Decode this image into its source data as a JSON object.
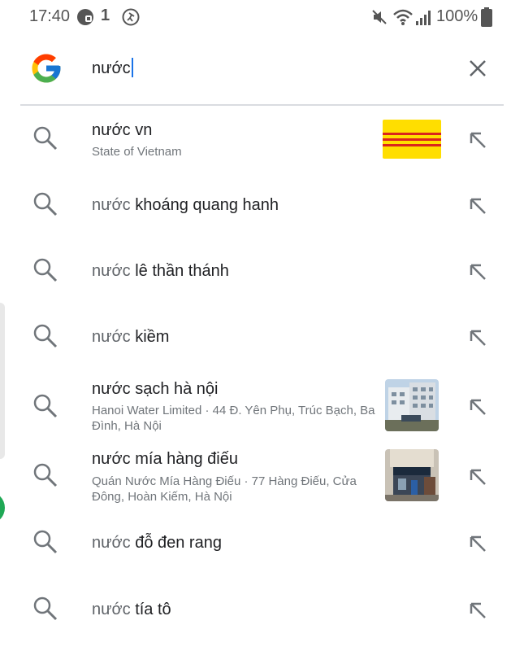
{
  "status_bar": {
    "time": "17:40",
    "battery": "100%",
    "icons": [
      "facebook-messenger-icon",
      "notification-count-icon",
      "activity-icon",
      "mute-icon",
      "wifi-icon",
      "signal-icon",
      "battery-icon"
    ],
    "notification_badge": "1"
  },
  "search": {
    "query": "nước",
    "logo": "google-logo",
    "clear_icon": "close-icon"
  },
  "suggestions": [
    {
      "prefix": "nước",
      "rest": " vn",
      "subtitle": "State of Vietnam",
      "thumb": "flag"
    },
    {
      "prefix": "nước",
      "rest": " khoáng quang hanh"
    },
    {
      "prefix": "nước",
      "rest": " lê thần thánh"
    },
    {
      "prefix": "nước",
      "rest": " kiềm"
    },
    {
      "prefix": "nước",
      "rest": " sạch hà nội",
      "subtitle": "Hanoi Water Limited · 44 Đ. Yên Phụ, Trúc Bạch, Ba Đình, Hà Nội",
      "thumb": "building-photo"
    },
    {
      "prefix": "nước",
      "rest": " mía hàng điếu",
      "subtitle": "Quán Nước Mía Hàng Điếu · 77 Hàng Điếu, Cửa Đông, Hoàn Kiếm, Hà Nội",
      "thumb": "shop-photo"
    },
    {
      "prefix": "nước",
      "rest": " đỗ đen rang"
    },
    {
      "prefix": "nước",
      "rest": " tía tô"
    }
  ],
  "colors": {
    "accent": "#1a73e8",
    "icon_gray": "#70757a",
    "flag_yellow": "#ffde00",
    "flag_red": "#da251d"
  }
}
